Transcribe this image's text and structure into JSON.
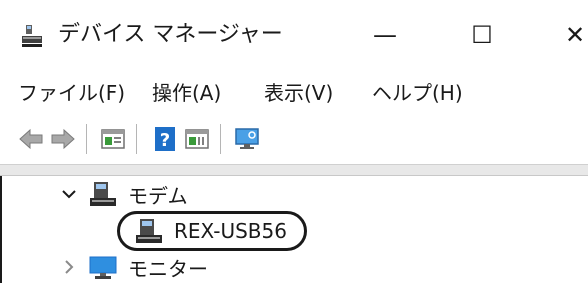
{
  "window": {
    "title": "デバイス マネージャー",
    "minimize_glyph": "—",
    "maximize_glyph": "☐",
    "close_glyph": "✕"
  },
  "menu": {
    "file": "ファイル(F)",
    "action": "操作(A)",
    "view": "表示(V)",
    "help": "ヘルプ(H)"
  },
  "toolbar": {
    "icons": [
      "back-arrow-icon",
      "forward-arrow-icon",
      "properties-icon",
      "help-icon",
      "update-driver-icon",
      "monitor-scan-icon"
    ]
  },
  "tree": {
    "modem_category": "モデム",
    "modem_device": "REX-USB56",
    "monitor_category": "モニター"
  },
  "colors": {
    "accent_blue": "#1e6fc8",
    "icon_gray": "#808080",
    "icon_green": "#3a9a3a"
  }
}
